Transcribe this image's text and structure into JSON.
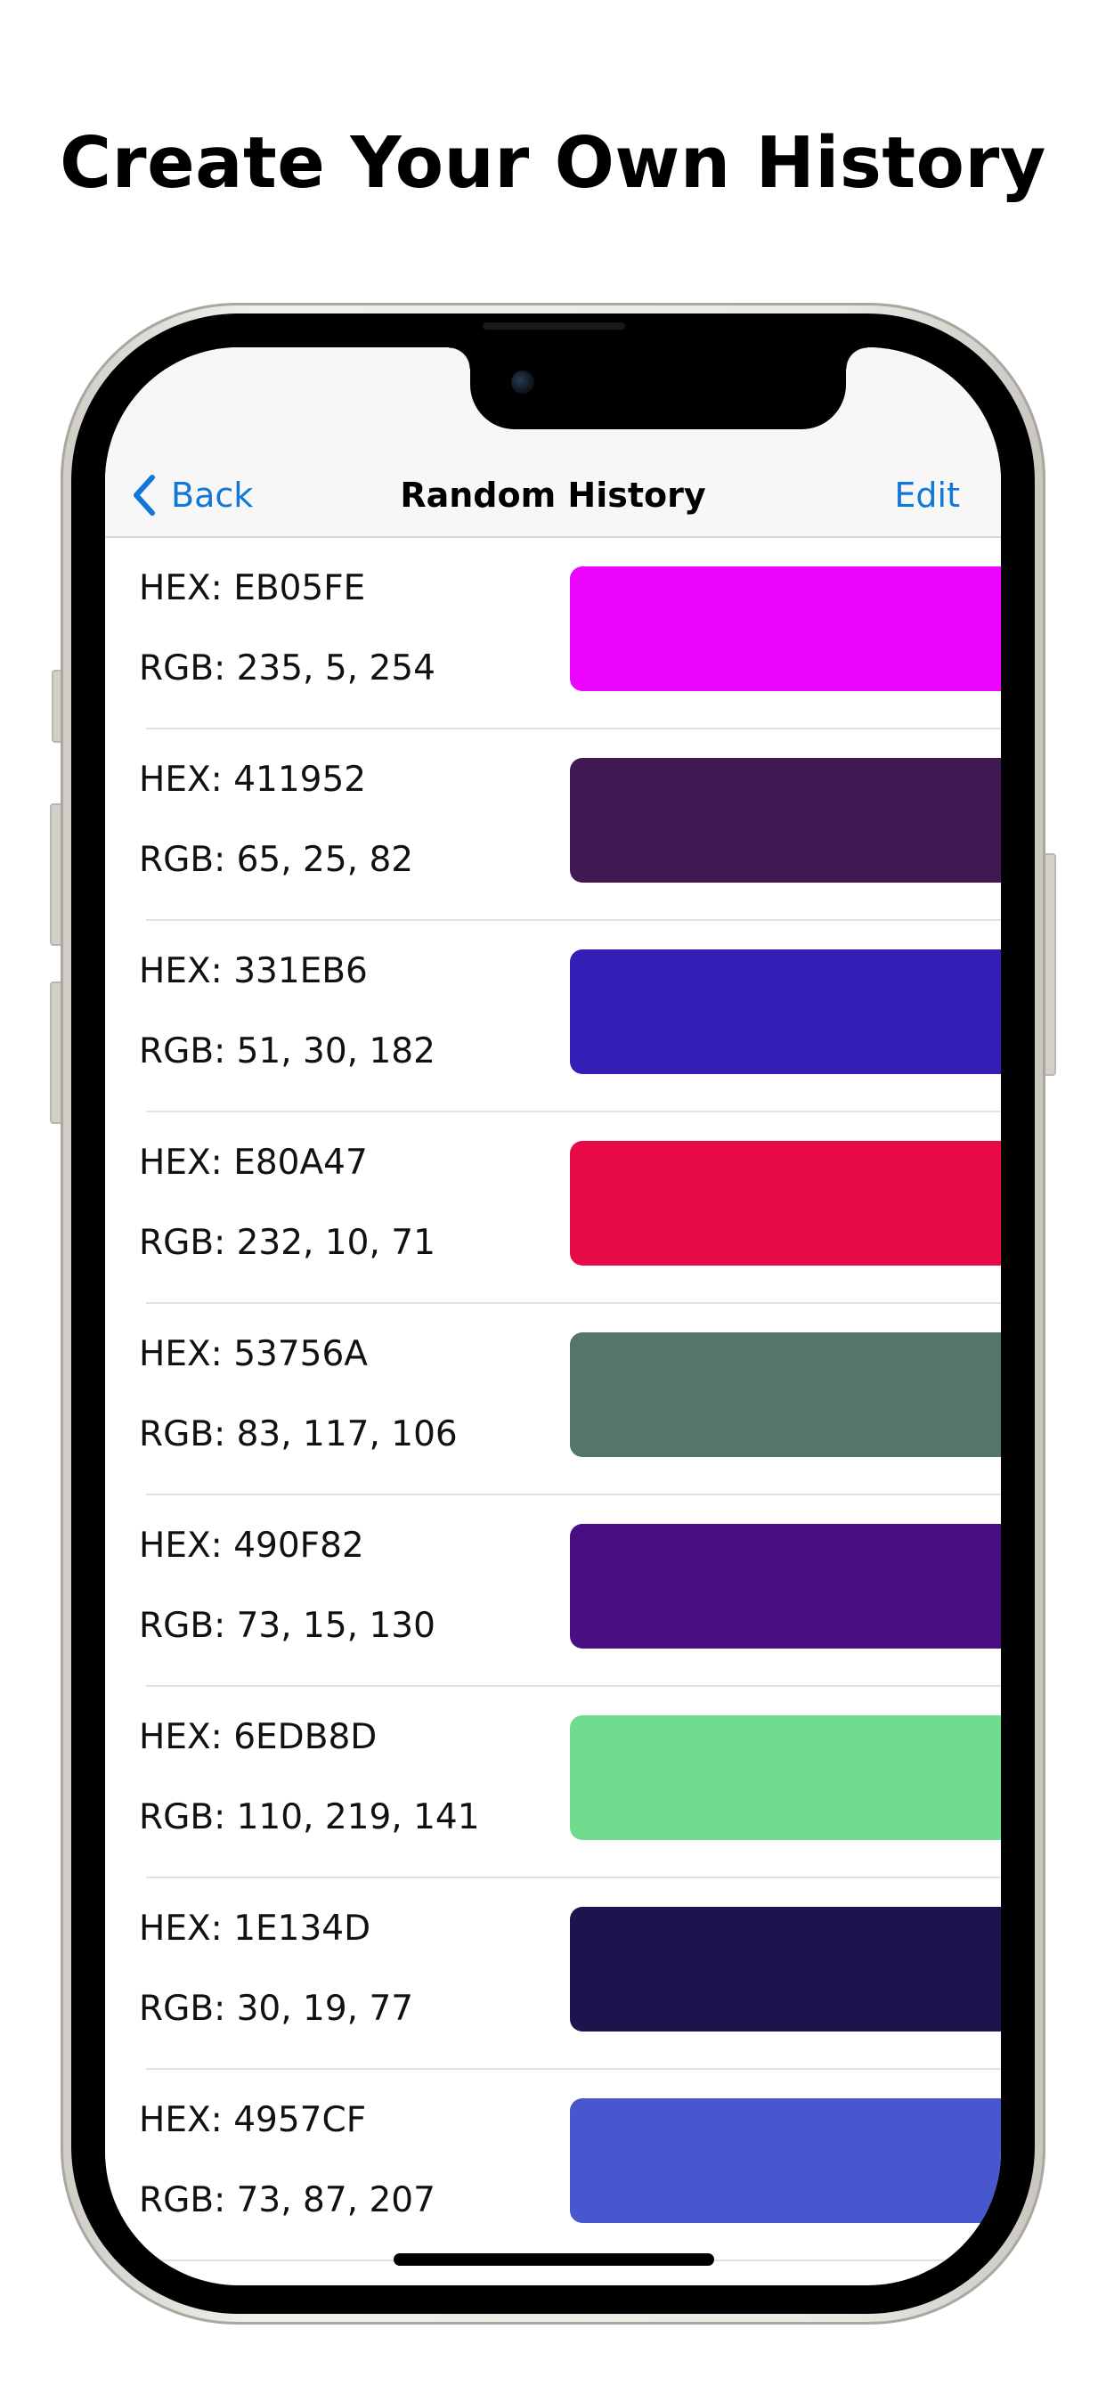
{
  "headline": "Create Your Own History",
  "navbar": {
    "back_label": "Back",
    "title": "Random History",
    "edit_label": "Edit",
    "accent_color": "#1177D8"
  },
  "history": [
    {
      "hex_label": "HEX: EB05FE",
      "rgb_label": "RGB: 235, 5, 254",
      "color": "#EB05FE"
    },
    {
      "hex_label": "HEX: 411952",
      "rgb_label": "RGB: 65, 25, 82",
      "color": "#411952"
    },
    {
      "hex_label": "HEX: 331EB6",
      "rgb_label": "RGB: 51, 30, 182",
      "color": "#331EB6"
    },
    {
      "hex_label": "HEX: E80A47",
      "rgb_label": "RGB: 232, 10, 71",
      "color": "#E80A47"
    },
    {
      "hex_label": "HEX: 53756A",
      "rgb_label": "RGB: 83, 117, 106",
      "color": "#53756A"
    },
    {
      "hex_label": "HEX: 490F82",
      "rgb_label": "RGB: 73, 15, 130",
      "color": "#490F82"
    },
    {
      "hex_label": "HEX: 6EDB8D",
      "rgb_label": "RGB: 110, 219, 141",
      "color": "#6EDB8D"
    },
    {
      "hex_label": "HEX: 1E134D",
      "rgb_label": "RGB: 30, 19, 77",
      "color": "#1E134D"
    },
    {
      "hex_label": "HEX: 4957CF",
      "rgb_label": "RGB: 73, 87, 207",
      "color": "#4957CF"
    }
  ]
}
